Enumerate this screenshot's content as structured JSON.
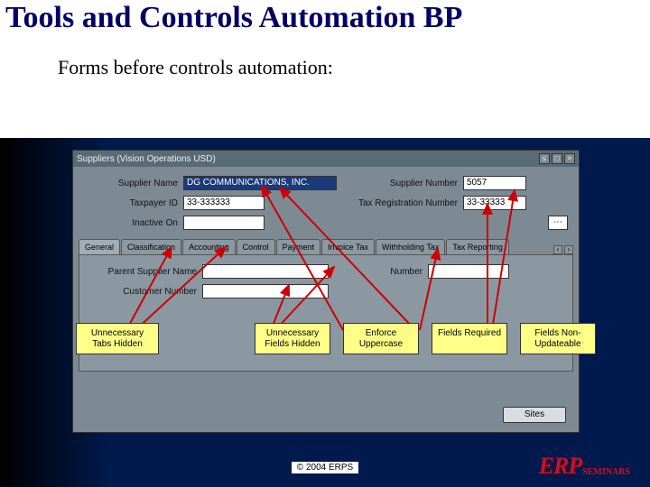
{
  "slide": {
    "title": "Tools and Controls Automation BP",
    "subtitle": "Forms before controls automation:",
    "copyright": "© 2004 ERPS",
    "logo_big": "ERP",
    "logo_small": "SEMINARS"
  },
  "window": {
    "title": "Suppliers (Vision Operations  USD)",
    "fields": {
      "supplier_name_label": "Supplier Name",
      "supplier_name_value": "DG COMMUNICATIONS, INC.",
      "supplier_number_label": "Supplier Number",
      "supplier_number_value": "5057",
      "taxpayer_id_label": "Taxpayer ID",
      "taxpayer_id_value": "33-333333",
      "tax_reg_label": "Tax Registration Number",
      "tax_reg_value": "33-33333",
      "inactive_on_label": "Inactive On",
      "inactive_on_value": "",
      "parent_supplier_label": "Parent Supplier Name",
      "parent_supplier_value": "",
      "number_label": "Number",
      "number_value": "",
      "customer_number_label": "Customer Number",
      "customer_number_value": ""
    },
    "tabs": [
      "General",
      "Classification",
      "Accounting",
      "Control",
      "Payment",
      "Invoice Tax",
      "Withholding Tax",
      "Tax Reporting"
    ],
    "sites_button": "Sites"
  },
  "callouts": {
    "c1": "Unnecessary Tabs Hidden",
    "c2": "Unnecessary Fields Hidden",
    "c3": "Enforce Uppercase",
    "c4": "Fields Required",
    "c5": "Fields Non-Updateable"
  }
}
